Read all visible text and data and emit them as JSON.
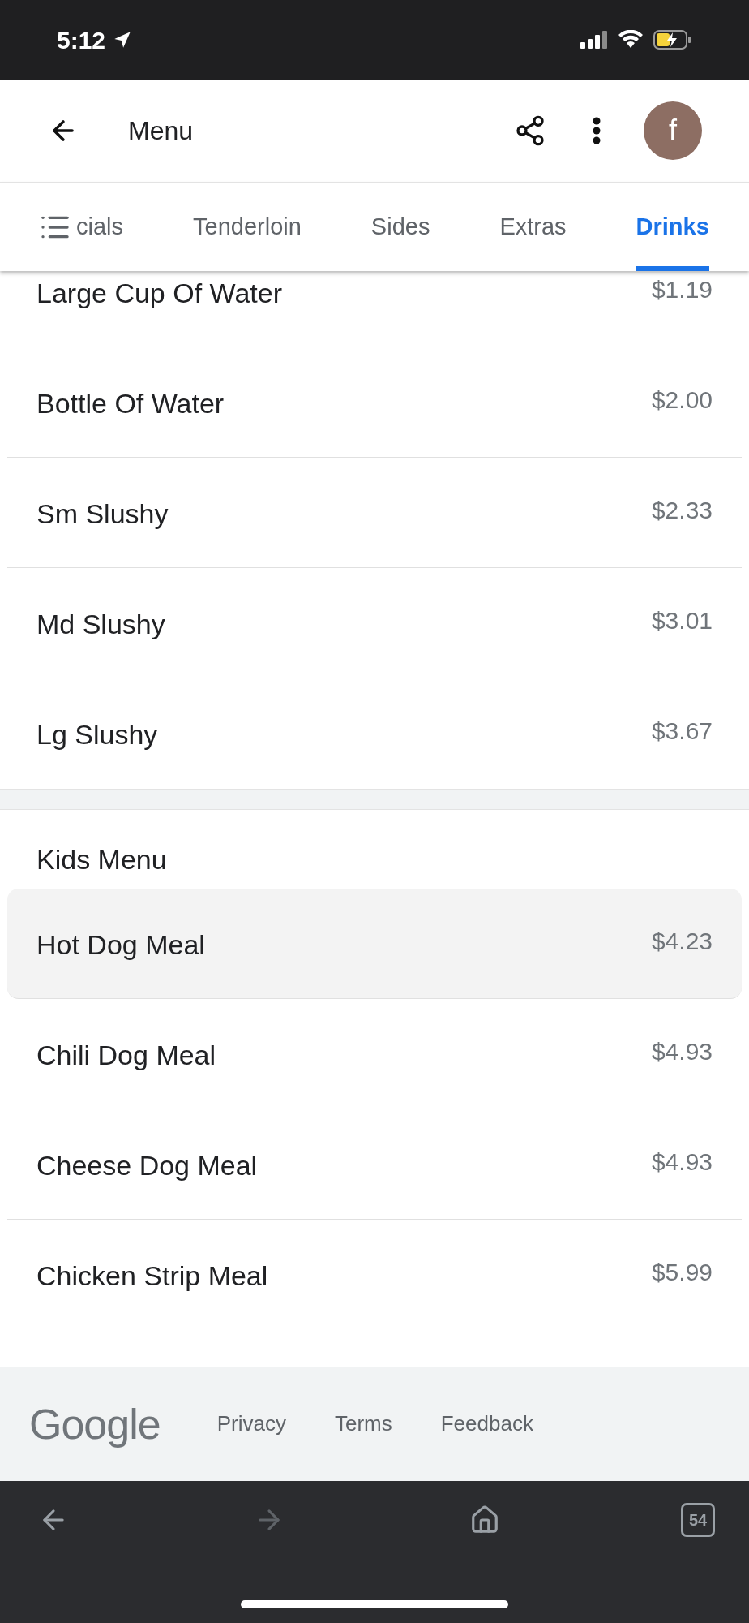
{
  "status_bar": {
    "time": "5:12"
  },
  "app_bar": {
    "title": "Menu",
    "avatar": "f"
  },
  "tabs": [
    {
      "label": "cials",
      "selected": false
    },
    {
      "label": "Tenderloin",
      "selected": false
    },
    {
      "label": "Sides",
      "selected": false
    },
    {
      "label": "Extras",
      "selected": false
    },
    {
      "label": "Drinks",
      "selected": true
    }
  ],
  "sections": [
    {
      "items": [
        {
          "name": "Large Cup Of Water",
          "price": "$1.19",
          "highlighted": false
        },
        {
          "name": "Bottle Of Water",
          "price": "$2.00",
          "highlighted": false
        },
        {
          "name": "Sm Slushy",
          "price": "$2.33",
          "highlighted": false
        },
        {
          "name": "Md Slushy",
          "price": "$3.01",
          "highlighted": false
        },
        {
          "name": "Lg Slushy",
          "price": "$3.67",
          "highlighted": false
        }
      ]
    },
    {
      "title": "Kids Menu",
      "items": [
        {
          "name": "Hot Dog Meal",
          "price": "$4.23",
          "highlighted": true
        },
        {
          "name": "Chili Dog Meal",
          "price": "$4.93",
          "highlighted": false
        },
        {
          "name": "Cheese Dog Meal",
          "price": "$4.93",
          "highlighted": false
        },
        {
          "name": "Chicken Strip Meal",
          "price": "$5.99",
          "highlighted": false
        }
      ]
    }
  ],
  "footer": {
    "logo": "Google",
    "links": [
      "Privacy",
      "Terms",
      "Feedback"
    ]
  },
  "browser_bar": {
    "tab_count": "54",
    "forward_disabled": true
  }
}
